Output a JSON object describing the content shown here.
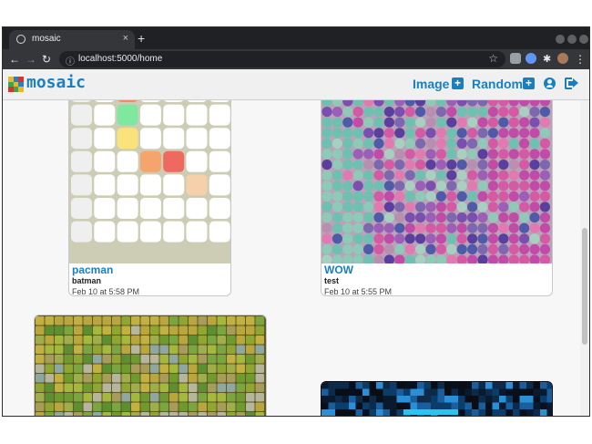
{
  "browser": {
    "tab_title": "mosaic",
    "tab_close": "×",
    "new_tab": "+",
    "url": "localhost:5000/home",
    "nav": {
      "back": "←",
      "forward": "→",
      "reload": "↻"
    },
    "star": "☆",
    "menu": "⋮"
  },
  "app": {
    "brand": "mosaic",
    "nav": [
      {
        "label": "Image",
        "icon": "plus-square-icon"
      },
      {
        "label": "Random",
        "icon": "plus-square-icon"
      }
    ],
    "user_icon": "user-circle-icon",
    "logout_icon": "sign-out-icon",
    "accent": "#1a7fbf"
  },
  "cards": [
    {
      "title": "pacman",
      "user": "batman",
      "date": "Feb 10 at 5:58 PM"
    },
    {
      "title": "WOW",
      "user": "test",
      "date": "Feb 10 at 5:55 PM"
    },
    {
      "title": "",
      "user": "",
      "date": ""
    },
    {
      "title": "",
      "user": "",
      "date": ""
    }
  ]
}
